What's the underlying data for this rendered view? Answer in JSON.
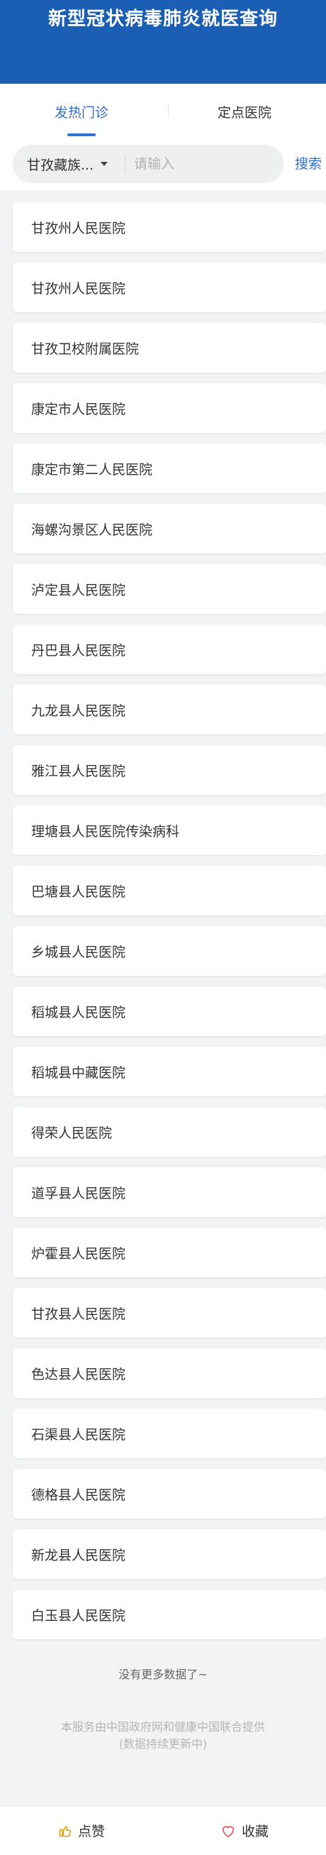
{
  "header": {
    "title": "新型冠状病毒肺炎就医查询"
  },
  "tabs": [
    {
      "label": "发热门诊",
      "active": true
    },
    {
      "label": "定点医院",
      "active": false
    }
  ],
  "search": {
    "region": "甘孜藏族...",
    "placeholder": "请输入",
    "button_label": "搜索"
  },
  "hospitals": [
    "甘孜州人民医院",
    "甘孜州人民医院",
    "甘孜卫校附属医院",
    "康定市人民医院",
    "康定市第二人民医院",
    "海螺沟景区人民医院",
    "泸定县人民医院",
    "丹巴县人民医院",
    "九龙县人民医院",
    "雅江县人民医院",
    "理塘县人民医院传染病科",
    "巴塘县人民医院",
    "乡城县人民医院",
    "稻城县人民医院",
    "稻城县中藏医院",
    "得荣人民医院",
    "道孚县人民医院",
    "炉霍县人民医院",
    "甘孜县人民医院",
    "色达县人民医院",
    "石渠县人民医院",
    "德格县人民医院",
    "新龙县人民医院",
    "白玉县人民医院"
  ],
  "list_end": "没有更多数据了~",
  "footer": {
    "line1": "本服务由中国政府网和健康中国联合提供",
    "line2": "(数据持续更新中)"
  },
  "bottom_bar": {
    "like_label": "点赞",
    "like_icon": "thumbs-up-icon",
    "collect_label": "收藏",
    "collect_icon": "heart-icon"
  },
  "colors": {
    "header_bg": "#1a5fb4",
    "accent": "#2f6fd0",
    "like_icon": "#e0a400",
    "collect_icon": "#e05050"
  }
}
